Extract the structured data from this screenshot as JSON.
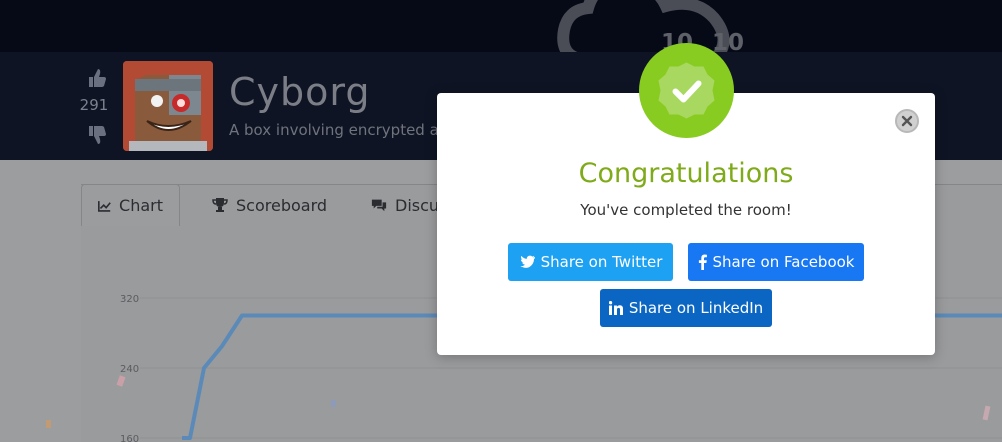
{
  "room": {
    "title": "Cyborg",
    "description": "A box involving encrypted are",
    "votes": "291"
  },
  "tabs": [
    {
      "label": "Chart",
      "icon": "chart-line-icon"
    },
    {
      "label": "Scoreboard",
      "icon": "trophy-icon"
    },
    {
      "label": "Discu",
      "icon": "comments-icon"
    }
  ],
  "cloud_badge": {
    "left_num": "10",
    "right_num": "10"
  },
  "chart_data": {
    "type": "line",
    "y_ticks": [
      "320",
      "240",
      "160"
    ],
    "y_tick_values": [
      320,
      240,
      160
    ],
    "series": [
      {
        "x": [
          0,
          1,
          2,
          3,
          4,
          5,
          6,
          7,
          8,
          9,
          10
        ],
        "values": [
          160,
          160,
          240,
          265,
          300,
          300,
          300,
          300,
          300,
          300,
          300
        ]
      }
    ],
    "ylim": [
      160,
      320
    ],
    "colors": {
      "line": "#5b8ab8",
      "grid": "#8f9093"
    }
  },
  "modal": {
    "title": "Congratulations",
    "subtitle": "You've completed the room!",
    "buttons": {
      "twitter": "Share on Twitter",
      "facebook": "Share on Facebook",
      "linkedin": "Share on LinkedIn"
    },
    "colors": {
      "title": "#7faa1a",
      "badge": "#88cc22",
      "twitter": "#1da1f2",
      "facebook": "#1877f2",
      "linkedin": "#0a66c2"
    }
  }
}
